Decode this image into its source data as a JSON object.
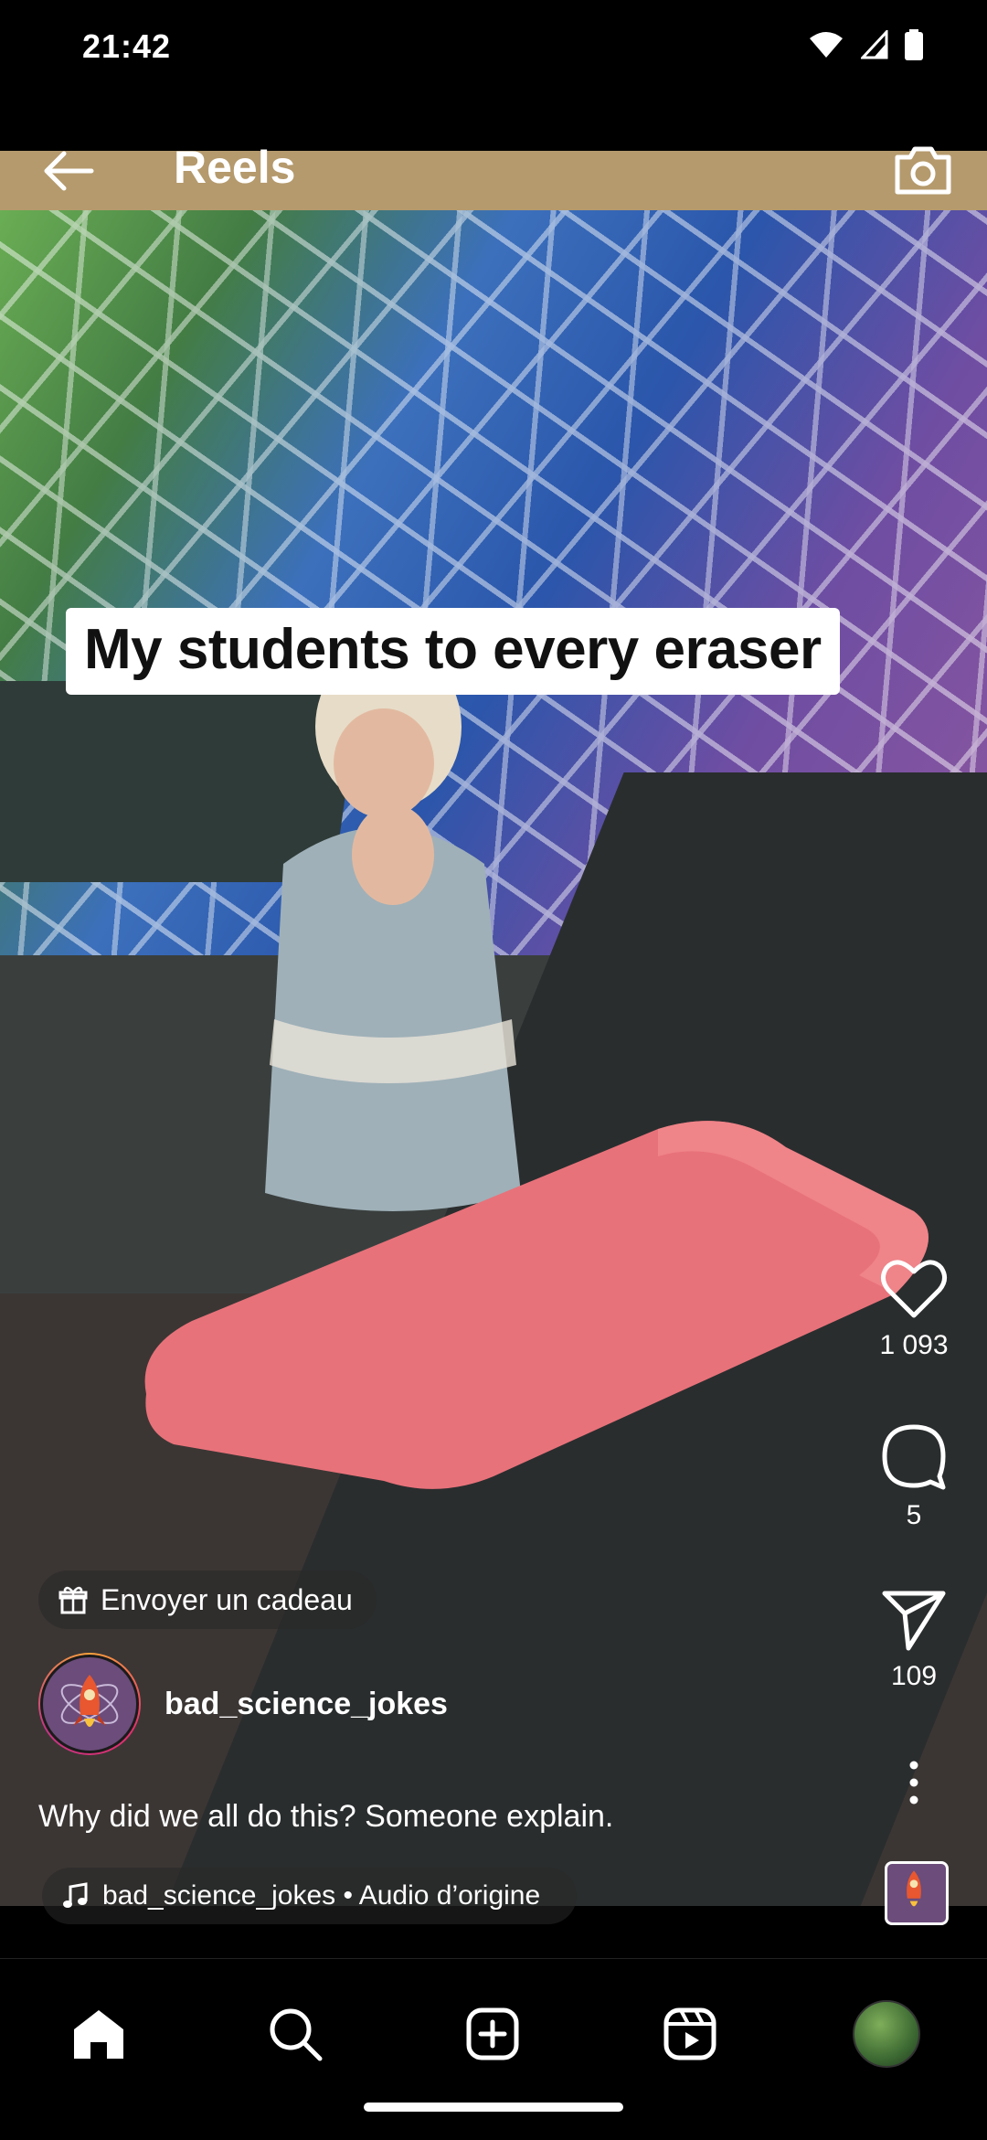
{
  "status_bar": {
    "time": "21:42"
  },
  "header": {
    "title": "Reels"
  },
  "video": {
    "caption": "My students to every eraser"
  },
  "actions": {
    "likes": "1 093",
    "comments": "5",
    "shares": "109"
  },
  "post": {
    "gift_label": "Envoyer un cadeau",
    "username": "bad_science_jokes",
    "description": "Why did we all do this? Someone explain.",
    "audio": "bad_science_jokes • Audio d’origine"
  },
  "icons": {
    "back": "arrow-left-icon",
    "camera": "camera-icon",
    "like": "heart-icon",
    "comment": "comment-icon",
    "share": "send-icon",
    "more": "more-vertical-icon",
    "gift": "gift-icon",
    "music": "music-note-icon",
    "nav": [
      "home-icon",
      "search-icon",
      "create-icon",
      "reels-icon",
      "profile-avatar"
    ]
  },
  "colors": {
    "caption_bg": "#ffffff",
    "eraser": "#e8727a",
    "nav_bg": "#000000"
  }
}
